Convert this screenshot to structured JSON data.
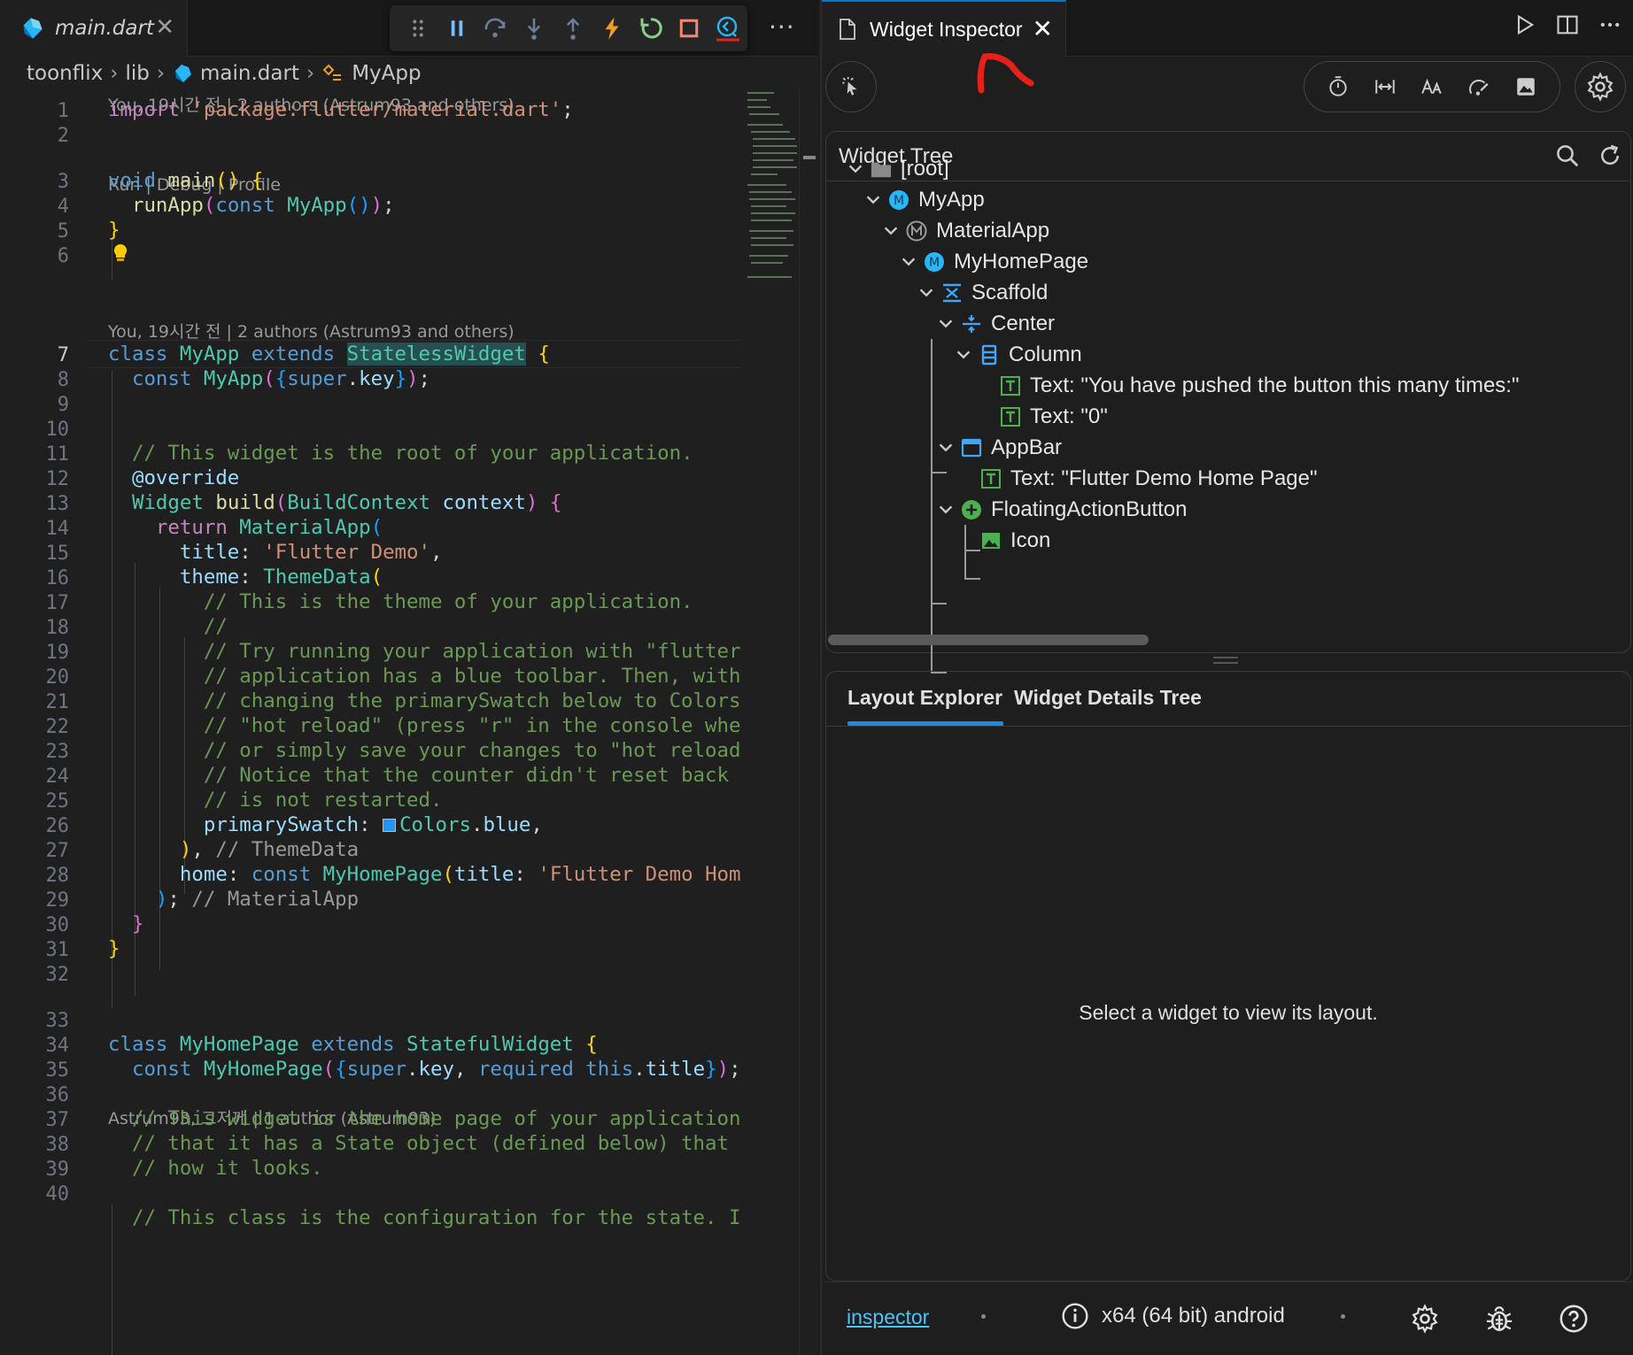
{
  "editor": {
    "tab": {
      "filename": "main.dart",
      "close_glyph": "✕"
    },
    "more_glyph": "···",
    "debug_toolbar": [
      "drag-handle-icon",
      "pause-icon",
      "step-over-icon",
      "step-into-icon",
      "step-out-icon",
      "hot-reload-icon",
      "hot-restart-icon",
      "stop-icon",
      "widget-inspector-icon"
    ],
    "breadcrumb": [
      "toonflix",
      "lib",
      "main.dart",
      "MyApp"
    ],
    "code_lenses": {
      "l1": "You, 19시간 전 | 2 authors (Astrum93 and others)",
      "l3": "Run | Debug | Profile",
      "l7": "You, 19시간 전 | 2 authors (Astrum93 and others)",
      "l33": "Astrum93, 그저께 | 1 author (Astrum93)"
    },
    "line_numbers": [
      "1",
      "2",
      "3",
      "4",
      "5",
      "6",
      "7",
      "8",
      "9",
      "10",
      "11",
      "12",
      "13",
      "14",
      "15",
      "16",
      "17",
      "18",
      "19",
      "20",
      "21",
      "22",
      "23",
      "24",
      "25",
      "26",
      "27",
      "28",
      "29",
      "30",
      "31",
      "32",
      "33",
      "34",
      "35",
      "36",
      "37",
      "38",
      "39",
      "40"
    ],
    "code": {
      "c11": "// This widget is the root of your application.",
      "c12": "@override",
      "c17": "// This is the theme of your application.",
      "c18": "//",
      "c19": "// Try running your application with \"flutter",
      "c20": "// application has a blue toolbar. Then, with",
      "c21": "// changing the primarySwatch below to Colors",
      "c22": "// \"hot reload\" (press \"r\" in the console whe",
      "c23": "// or simply save your changes to \"hot reload",
      "c24": "// Notice that the counter didn't reset back",
      "c25": "// is not restarted.",
      "c36": "// This widget is the home page of your application",
      "c37": "// that it has a State object (defined below) that",
      "c38": "// how it looks.",
      "c40": "// This class is the configuration for the state. I"
    }
  },
  "inspector": {
    "tab": {
      "title": "Widget Inspector",
      "close_glyph": "✕"
    },
    "widget_tree": {
      "title": "Widget Tree",
      "nodes": [
        {
          "label": "[root]",
          "icon": "folder-icon"
        },
        {
          "label": "MyApp",
          "icon": "m-icon"
        },
        {
          "label": "MaterialApp",
          "icon": "material-icon"
        },
        {
          "label": "MyHomePage",
          "icon": "m-icon"
        },
        {
          "label": "Scaffold",
          "icon": "scaffold-icon"
        },
        {
          "label": "Center",
          "icon": "center-icon"
        },
        {
          "label": "Column",
          "icon": "column-icon"
        },
        {
          "label": "Text: \"You have pushed the button this many times:\"",
          "icon": "text-icon"
        },
        {
          "label": "Text: \"0\"",
          "icon": "text-icon"
        },
        {
          "label": "AppBar",
          "icon": "appbar-icon"
        },
        {
          "label": "Text: \"Flutter Demo Home Page\"",
          "icon": "text-icon"
        },
        {
          "label": "FloatingActionButton",
          "icon": "fab-icon"
        },
        {
          "label": "Icon",
          "icon": "image-icon"
        }
      ]
    },
    "details": {
      "tabs": [
        "Layout Explorer",
        "Widget Details Tree"
      ],
      "empty_message": "Select a widget to view its layout."
    },
    "status": {
      "link": "inspector",
      "device": "x64 (64 bit) android"
    }
  },
  "colors": {
    "accent": "#1e88e5",
    "annotation_red": "#e8201a",
    "text_widget_green": "#4caf50",
    "widget_blue": "#29b6f6"
  }
}
